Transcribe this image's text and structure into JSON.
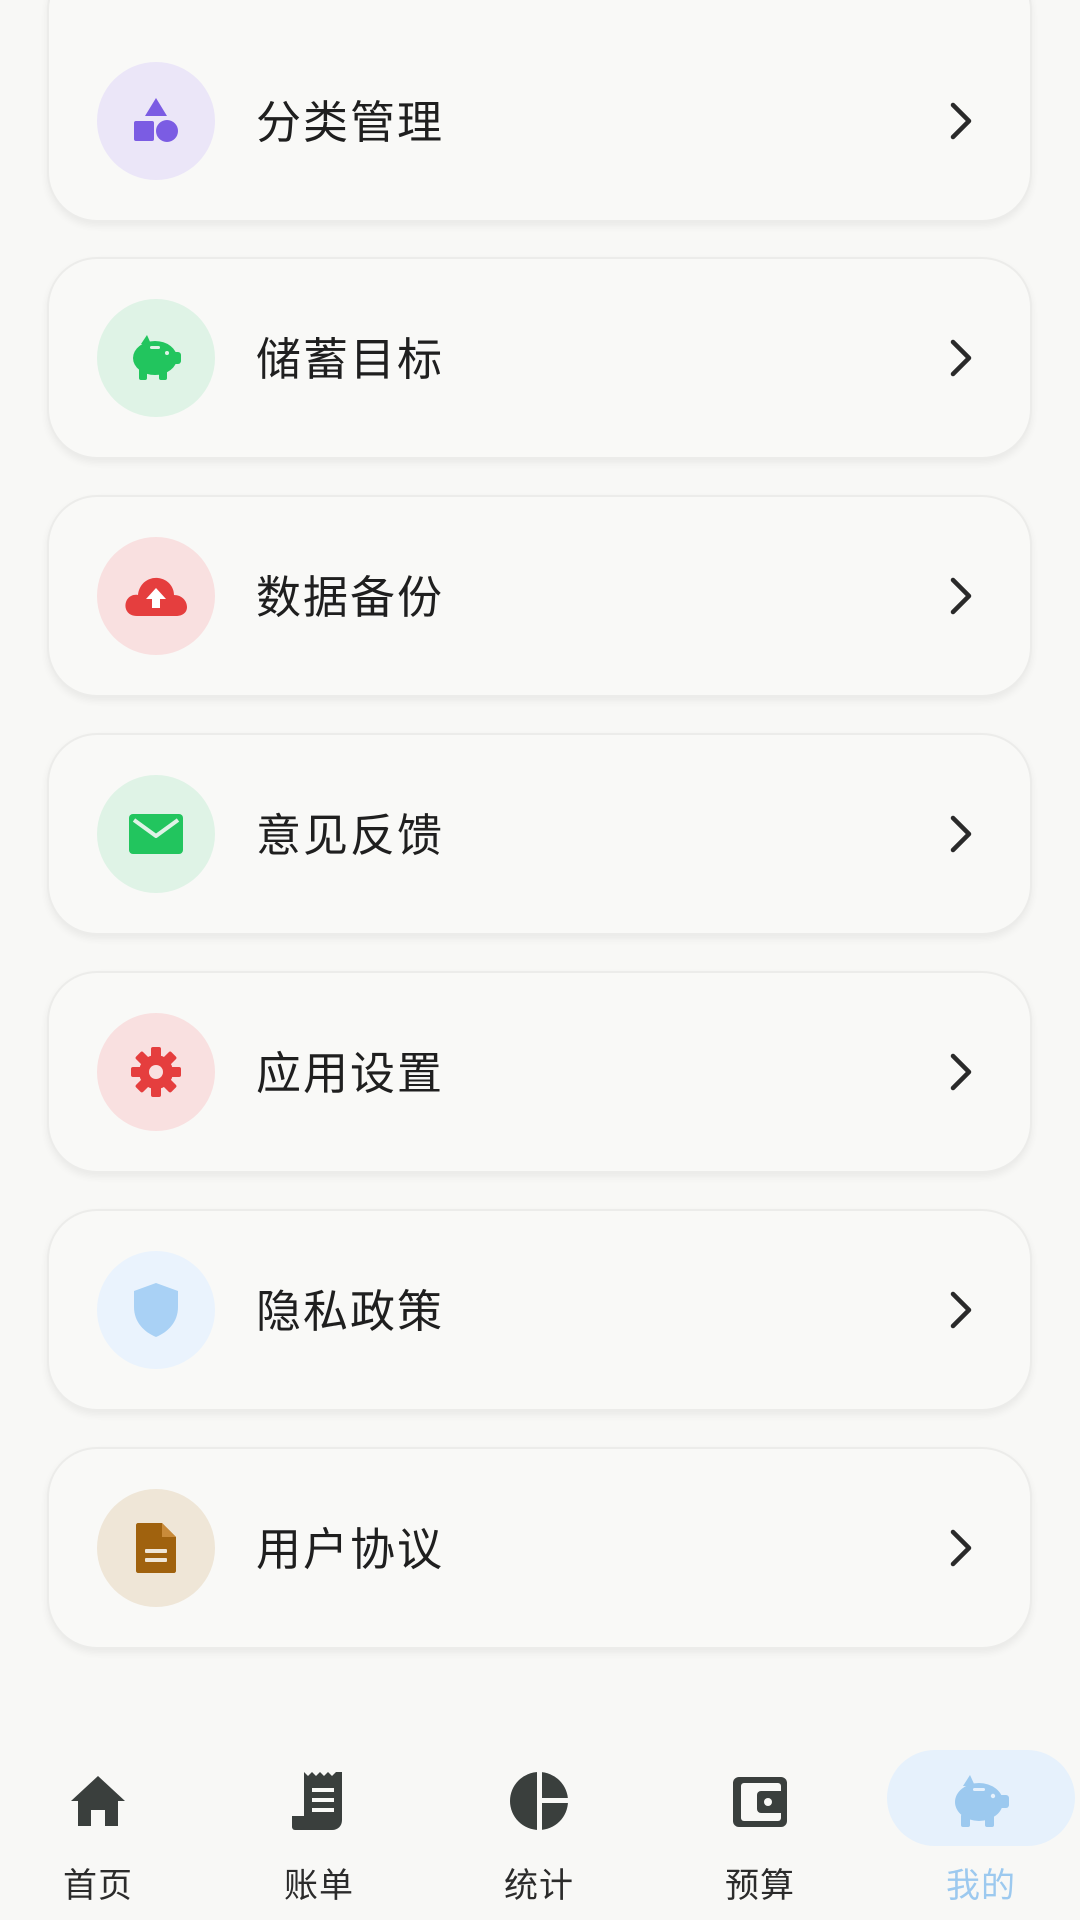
{
  "menu": {
    "items": [
      {
        "label": "分类管理",
        "icon": "shapes-icon",
        "icon_color": "#7b5ce3",
        "bg_color": "#ebe6f8"
      },
      {
        "label": "储蓄目标",
        "icon": "piggy-bank-icon",
        "icon_color": "#22c55e",
        "bg_color": "#dff3e6"
      },
      {
        "label": "数据备份",
        "icon": "cloud-upload-icon",
        "icon_color": "#e53e3e",
        "bg_color": "#f9e0e0"
      },
      {
        "label": "意见反馈",
        "icon": "mail-icon",
        "icon_color": "#22c55e",
        "bg_color": "#dff3e6"
      },
      {
        "label": "应用设置",
        "icon": "gear-icon",
        "icon_color": "#e53e3e",
        "bg_color": "#f9e0e0"
      },
      {
        "label": "隐私政策",
        "icon": "shield-icon",
        "icon_color": "#a9d1f5",
        "bg_color": "#eaf3fd"
      },
      {
        "label": "用户协议",
        "icon": "document-icon",
        "icon_color": "#a0620e",
        "bg_color": "#efe6d7"
      }
    ]
  },
  "nav": {
    "items": [
      {
        "label": "首页",
        "icon": "home-icon"
      },
      {
        "label": "账单",
        "icon": "receipt-icon"
      },
      {
        "label": "统计",
        "icon": "pie-chart-icon"
      },
      {
        "label": "预算",
        "icon": "wallet-icon"
      },
      {
        "label": "我的",
        "icon": "piggy-bank-icon",
        "active": true
      }
    ],
    "active_color": "#9cc9ef",
    "text_color": "#2b2b2b"
  }
}
